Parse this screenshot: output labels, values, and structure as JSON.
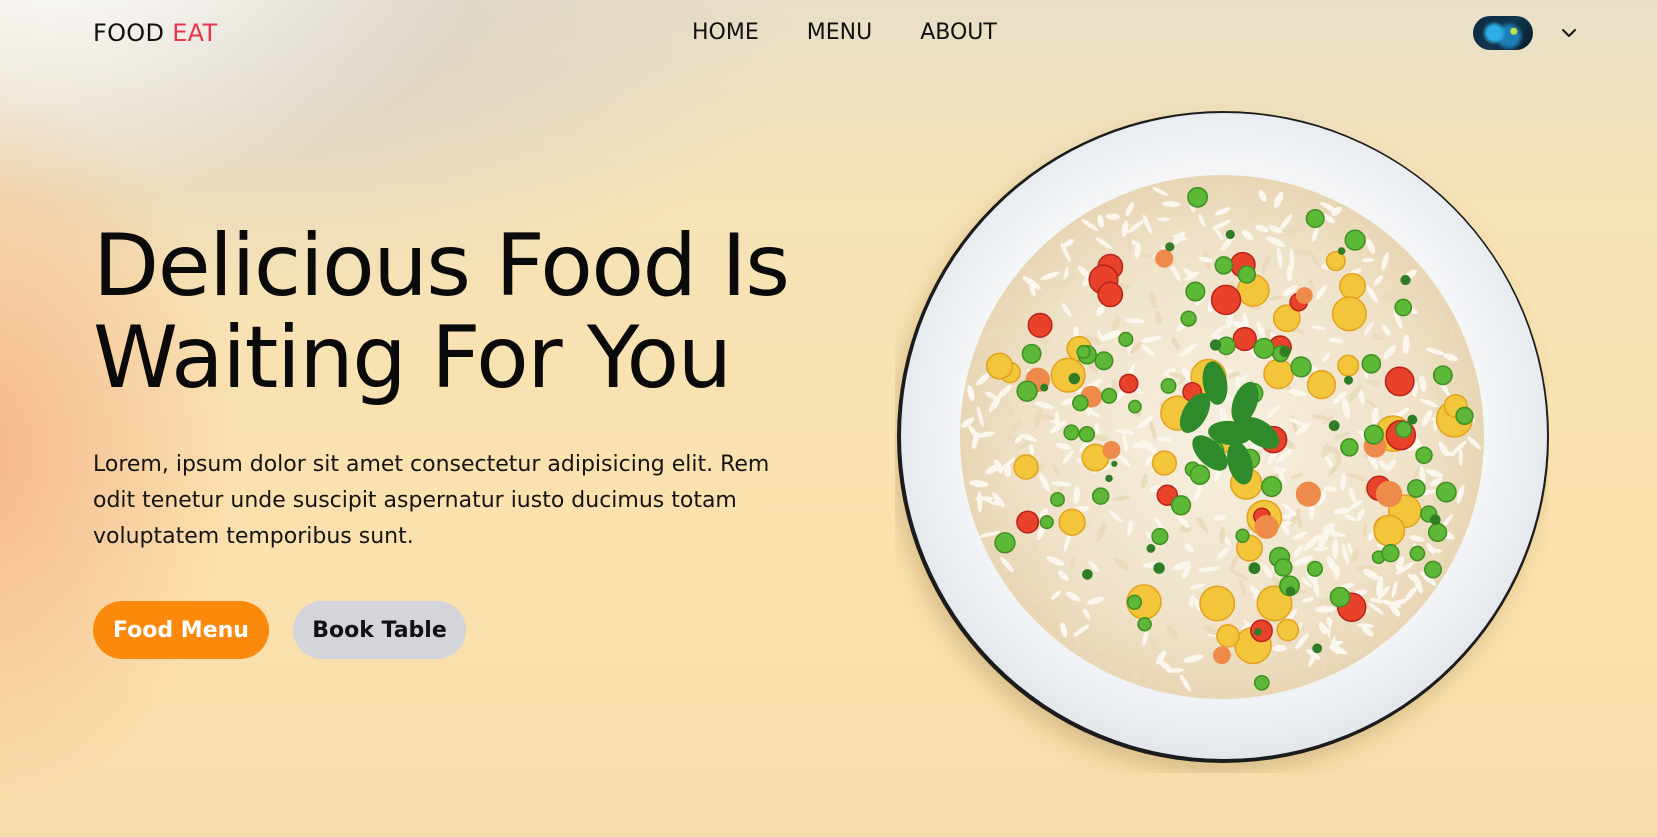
{
  "header": {
    "logo": {
      "part1": "FOOD",
      "part2": "EAT"
    },
    "nav": [
      {
        "label": "HOME"
      },
      {
        "label": "MENU"
      },
      {
        "label": "ABOUT"
      }
    ]
  },
  "hero": {
    "title_line1": "Delicious Food Is",
    "title_line2": "Waiting For You",
    "description": "Lorem, ipsum dolor sit amet consectetur adipisicing elit. Rem odit tenetur unde suscipit aspernatur iusto ducimus totam voluptatem temporibus sunt.",
    "buttons": {
      "primary": "Food Menu",
      "secondary": "Book Table"
    }
  },
  "icons": {
    "user": "avatar-image",
    "menu_toggle": "chevron-down-icon"
  },
  "colors": {
    "accent": "#e8344a",
    "primary_button": "#fb8a0c",
    "secondary_button": "#d3d5db",
    "background": "#fbe1ad"
  }
}
